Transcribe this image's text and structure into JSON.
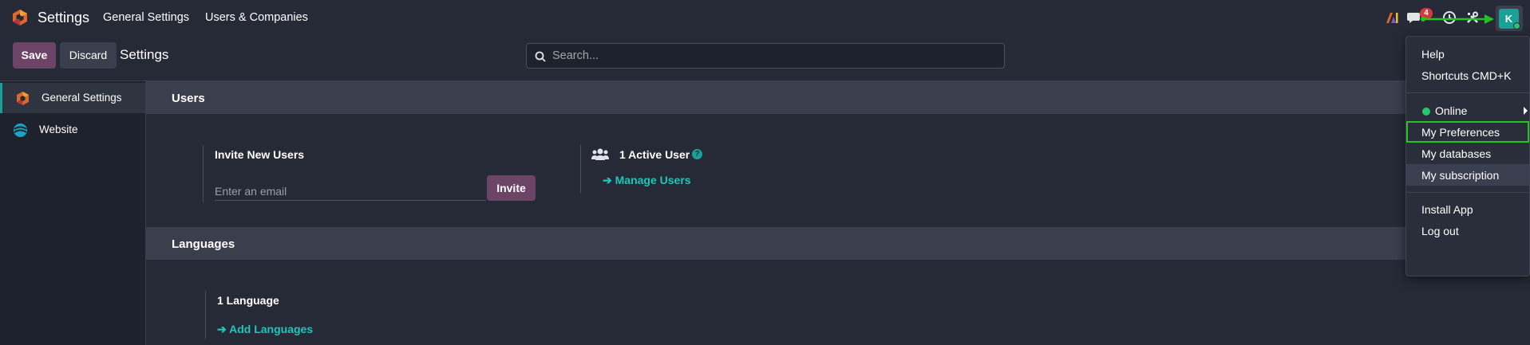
{
  "navbar": {
    "app_name": "Settings",
    "menu": [
      "General Settings",
      "Users & Companies"
    ],
    "chat_count": "4",
    "avatar_initial": "K",
    "icons": [
      "odoo-logo-icon",
      "ai-icon",
      "chat-icon",
      "clock-icon",
      "tools-icon"
    ]
  },
  "control": {
    "save_label": "Save",
    "discard_label": "Discard",
    "breadcrumb": "Settings",
    "search_placeholder": "Search..."
  },
  "sidebar": {
    "items": [
      {
        "label": "General Settings",
        "active": true
      },
      {
        "label": "Website",
        "active": false
      }
    ]
  },
  "sections": {
    "users": {
      "title": "Users",
      "invite_title": "Invite New Users",
      "email_placeholder": "Enter an email",
      "invite_button": "Invite",
      "active_users": "1 Active User",
      "manage_users": "Manage Users"
    },
    "languages": {
      "title": "Languages",
      "count": "1 Language",
      "add_languages": "Add Languages"
    }
  },
  "user_menu": {
    "items": [
      "Help",
      "Shortcuts CMD+K",
      "Online",
      "My Preferences",
      "My databases",
      "My subscription",
      "Install App",
      "Log out"
    ]
  },
  "colors": {
    "background": "#262a36",
    "primary": "#6c4466",
    "accent": "#1aa197",
    "link": "#1ec7ba",
    "highlight": "#22c322"
  }
}
